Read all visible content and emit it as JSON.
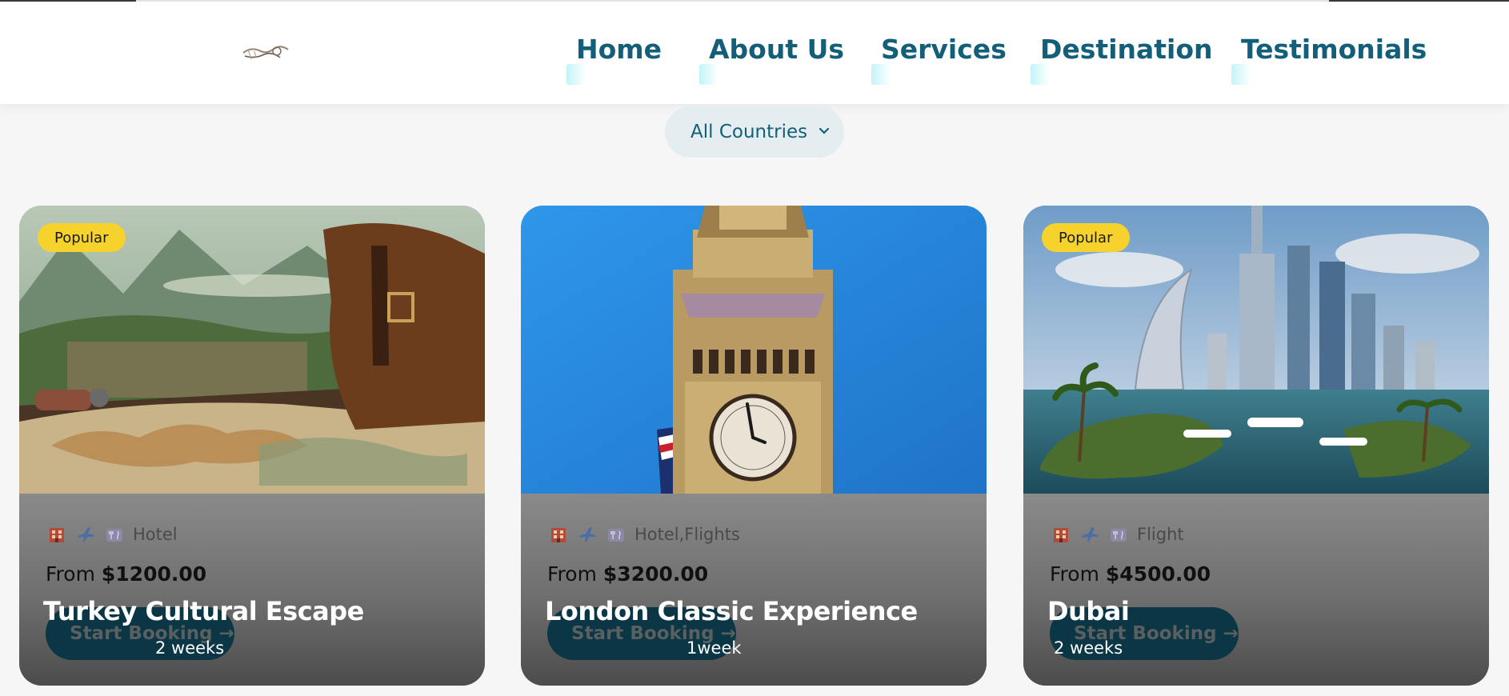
{
  "nav": {
    "items": [
      "Home",
      "About Us",
      "Services",
      "Destination",
      "Testimonials"
    ]
  },
  "filter": {
    "selected": "All Countries"
  },
  "cards": [
    {
      "badge": "Popular",
      "amenities": "Hotel",
      "price_prefix": "From",
      "price": "$1200.00",
      "title": "Turkey Cultural Escape",
      "button": "Start Booking →",
      "duration": "2 weeks"
    },
    {
      "badge": "",
      "amenities": "Hotel,Flights",
      "price_prefix": "From",
      "price": "$3200.00",
      "title": "London Classic Experience",
      "button": "Start Booking →",
      "duration": "1week"
    },
    {
      "badge": "Popular",
      "amenities": "Flight",
      "price_prefix": "From",
      "price": "$4500.00",
      "title": "Dubai",
      "button": "Start Booking →",
      "duration": "2 weeks"
    }
  ],
  "icons": [
    "hotel-icon",
    "plane-icon",
    "dining-icon",
    "chevron-down-icon"
  ],
  "colors": {
    "brand": "#135e79",
    "badge": "#f6d22c",
    "button": "#0a3645"
  }
}
